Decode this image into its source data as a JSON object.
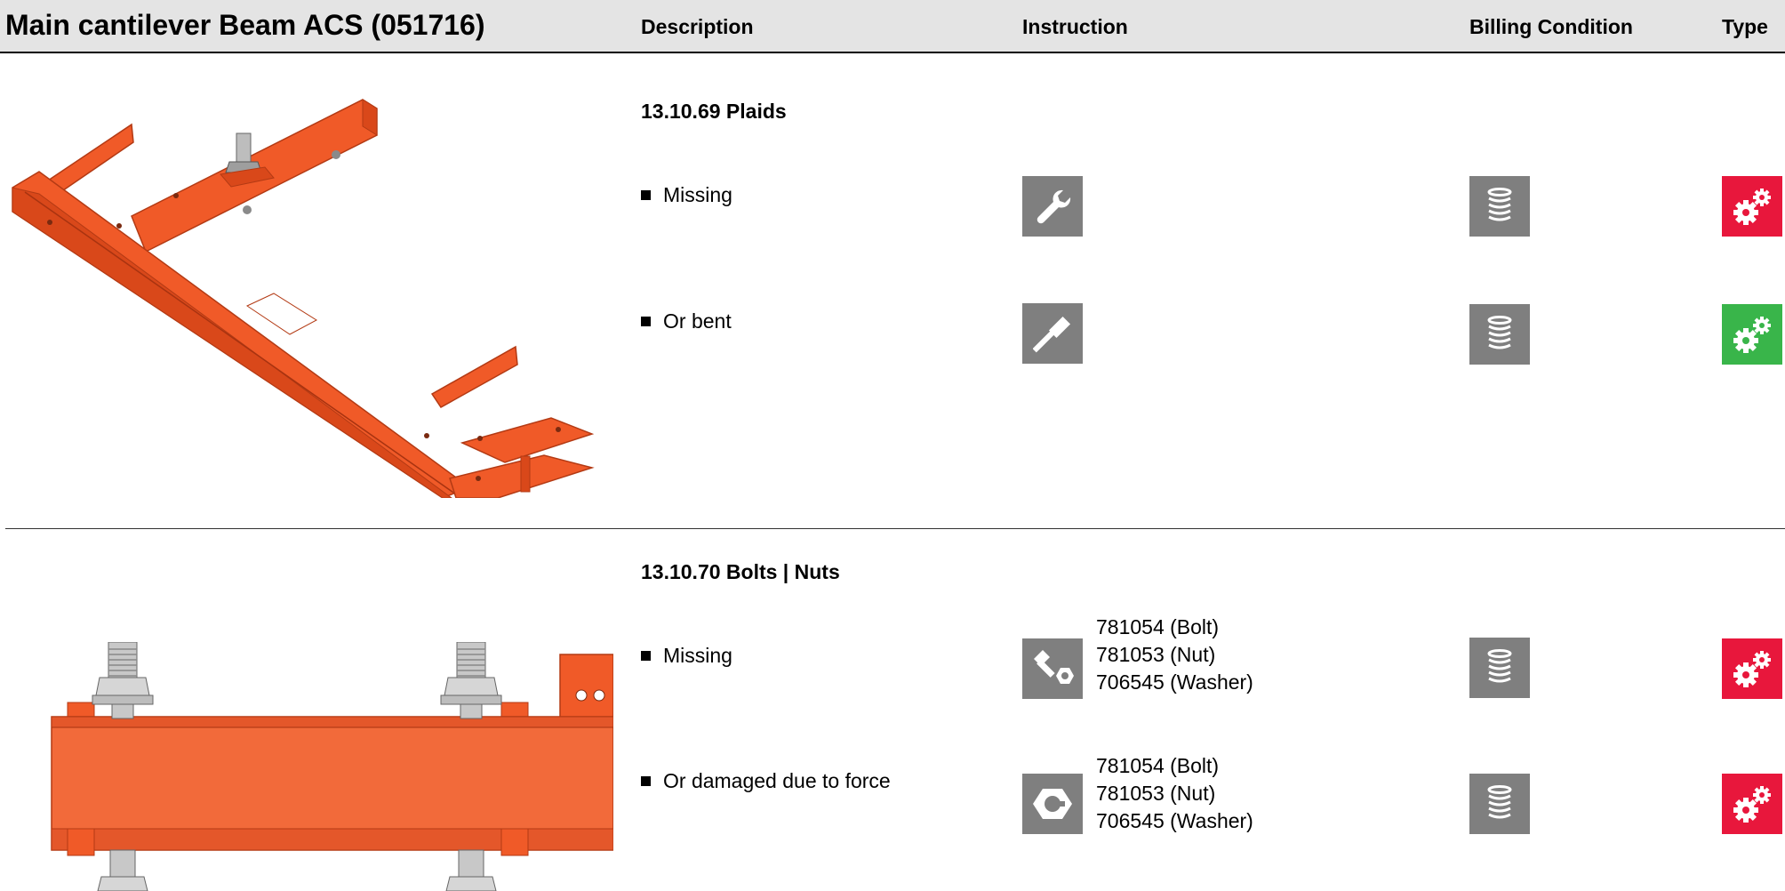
{
  "header": {
    "title": "Main cantilever Beam ACS (051716)",
    "col_description": "Description",
    "col_instruction": "Instruction",
    "col_billing": "Billing Condition",
    "col_type": "Type"
  },
  "colors": {
    "header_bg": "#e4e4e4",
    "icon_grey": "#7f7f7f",
    "type_red": "#e8173c",
    "type_green": "#39b54a",
    "beam_orange": "#f05a28"
  },
  "sections": [
    {
      "title": "13.10.69 Plaids",
      "image": "main-cantilever-beam-illustration",
      "rows": [
        {
          "description": "Missing",
          "instruction_icon": "wrench-icon",
          "parts": [],
          "billing_icon": "coin-stack-icon",
          "type_icon": "gears-icon",
          "type_color": "red"
        },
        {
          "description": "Or bent",
          "instruction_icon": "hammer-icon",
          "parts": [],
          "billing_icon": "coin-stack-icon",
          "type_icon": "gears-icon",
          "type_color": "green"
        }
      ]
    },
    {
      "title": "13.10.70 Bolts | Nuts",
      "image": "beam-bolts-nuts-illustration",
      "rows": [
        {
          "description": "Missing",
          "instruction_icon": "bolt-nut-icon",
          "parts": [
            "781054 (Bolt)",
            "781053 (Nut)",
            "706545 (Washer)"
          ],
          "billing_icon": "coin-stack-icon",
          "type_icon": "gears-icon",
          "type_color": "red"
        },
        {
          "description": "Or damaged due to force",
          "instruction_icon": "nut-icon",
          "parts": [
            "781054 (Bolt)",
            "781053 (Nut)",
            "706545 (Washer)"
          ],
          "billing_icon": "coin-stack-icon",
          "type_icon": "gears-icon",
          "type_color": "red"
        }
      ]
    }
  ]
}
